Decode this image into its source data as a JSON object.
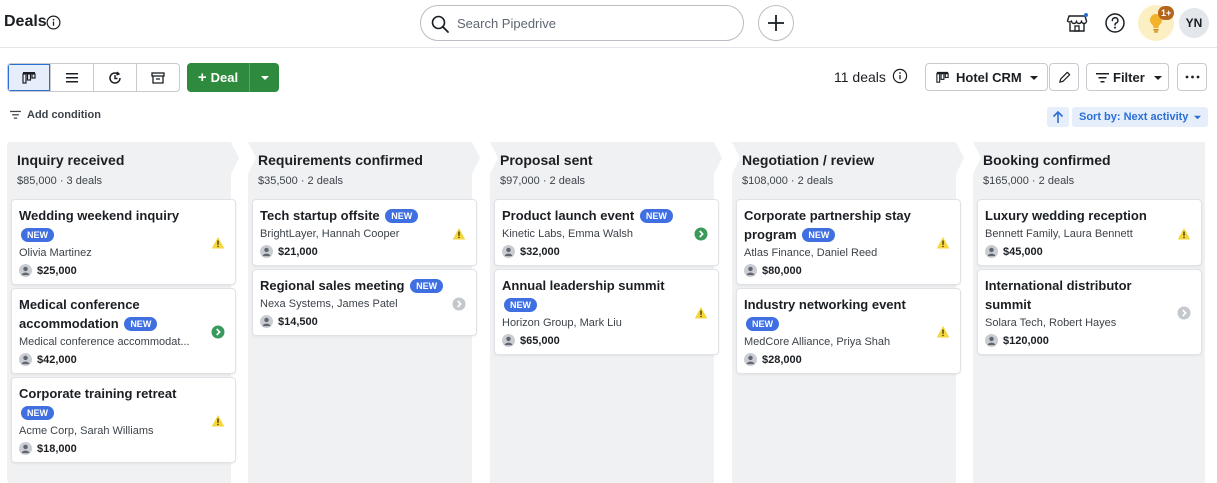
{
  "header": {
    "title": "Deals",
    "search_placeholder": "Search Pipedrive",
    "notification_badge": "1+",
    "avatar_initials": "YN"
  },
  "toolbar": {
    "new_deal_label": "Deal",
    "deals_count": "11 deals",
    "pipeline_label": "Hotel CRM",
    "filter_label": "Filter",
    "add_condition_label": "Add condition",
    "sort_label": "Sort by: Next activity"
  },
  "colors": {
    "accent_green": "#2e8b3e",
    "badge_blue": "#3f6fe0",
    "warning_yellow": "#f5d63d",
    "status_green": "#3a9a5b",
    "status_gray": "#c4c8cd",
    "column_bg": "#f0f1f2"
  },
  "columns": [
    {
      "title": "Inquiry received",
      "summary": "$85,000 · 3 deals",
      "cards": [
        {
          "title": "Wedding weekend inquiry",
          "is_new": true,
          "new_label": "NEW",
          "org": "Olivia Martinez",
          "value": "$25,000",
          "status": "warning-icon"
        },
        {
          "title": "Medical conference accommodation",
          "is_new": true,
          "new_label": "NEW",
          "org": "Medical conference accommodat...",
          "value": "$42,000",
          "status": "next-green-icon"
        },
        {
          "title": "Corporate training retreat",
          "is_new": true,
          "new_label": "NEW",
          "org": "Acme Corp, Sarah Williams",
          "value": "$18,000",
          "status": "warning-icon"
        }
      ]
    },
    {
      "title": "Requirements confirmed",
      "summary": "$35,500 · 2 deals",
      "cards": [
        {
          "title": "Tech startup offsite",
          "is_new": true,
          "new_label": "NEW",
          "org": "BrightLayer, Hannah Cooper",
          "value": "$21,000",
          "status": "warning-icon"
        },
        {
          "title": "Regional sales meeting",
          "is_new": true,
          "new_label": "NEW",
          "org": "Nexa Systems, James Patel",
          "value": "$14,500",
          "status": "next-gray-icon"
        }
      ]
    },
    {
      "title": "Proposal sent",
      "summary": "$97,000 · 2 deals",
      "cards": [
        {
          "title": "Product launch event",
          "is_new": true,
          "new_label": "NEW",
          "org": "Kinetic Labs, Emma Walsh",
          "value": "$32,000",
          "status": "next-green-icon"
        },
        {
          "title": "Annual leadership summit",
          "is_new": true,
          "new_label": "NEW",
          "org": "Horizon Group, Mark Liu",
          "value": "$65,000",
          "status": "warning-icon"
        }
      ]
    },
    {
      "title": "Negotiation / review",
      "summary": "$108,000 · 2 deals",
      "cards": [
        {
          "title": "Corporate partnership stay program",
          "is_new": true,
          "new_label": "NEW",
          "org": "Atlas Finance, Daniel Reed",
          "value": "$80,000",
          "status": "warning-icon"
        },
        {
          "title": "Industry networking event",
          "is_new": true,
          "new_label": "NEW",
          "org": "MedCore Alliance, Priya Shah",
          "value": "$28,000",
          "status": "warning-icon"
        }
      ]
    },
    {
      "title": "Booking confirmed",
      "summary": "$165,000 · 2 deals",
      "cards": [
        {
          "title": "Luxury wedding reception",
          "is_new": false,
          "new_label": "",
          "org": "Bennett Family, Laura Bennett",
          "value": "$45,000",
          "status": "warning-icon"
        },
        {
          "title": "International distributor summit",
          "is_new": false,
          "new_label": "",
          "org": "Solara Tech, Robert Hayes",
          "value": "$120,000",
          "status": "next-gray-icon"
        }
      ]
    }
  ]
}
